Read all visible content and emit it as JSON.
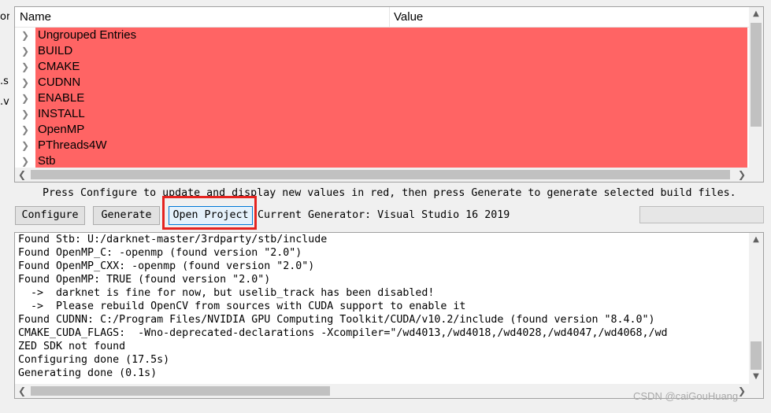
{
  "left_strip": {
    "items": [
      "or",
      ".s",
      ".v"
    ]
  },
  "tree": {
    "column_name": "Name",
    "column_value": "Value",
    "row_color": "#ff6464",
    "rows": [
      "Ungrouped Entries",
      "BUILD",
      "CMAKE",
      "CUDNN",
      "ENABLE",
      "INSTALL",
      "OpenMP",
      "PThreads4W",
      "Stb"
    ]
  },
  "hint": "Press Configure to update and display new values in red, then press Generate to generate selected build files.",
  "buttons": {
    "configure": "Configure",
    "generate": "Generate",
    "open_project": "Open Project"
  },
  "generator": "Current Generator: Visual Studio 16 2019",
  "highlight_color": "#e5231f",
  "log": {
    "lines": [
      "Found Stb: U:/darknet-master/3rdparty/stb/include",
      "Found OpenMP_C: -openmp (found version \"2.0\")",
      "Found OpenMP_CXX: -openmp (found version \"2.0\")",
      "Found OpenMP: TRUE (found version \"2.0\")",
      "  ->  darknet is fine for now, but uselib_track has been disabled!",
      "  ->  Please rebuild OpenCV from sources with CUDA support to enable it",
      "Found CUDNN: C:/Program Files/NVIDIA GPU Computing Toolkit/CUDA/v10.2/include (found version \"8.4.0\")",
      "CMAKE_CUDA_FLAGS:  -Wno-deprecated-declarations -Xcompiler=\"/wd4013,/wd4018,/wd4028,/wd4047,/wd4068,/wd",
      "ZED SDK not found",
      "Configuring done (17.5s)",
      "Generating done (0.1s)"
    ]
  },
  "watermark": "CSDN @caiGouHuang"
}
